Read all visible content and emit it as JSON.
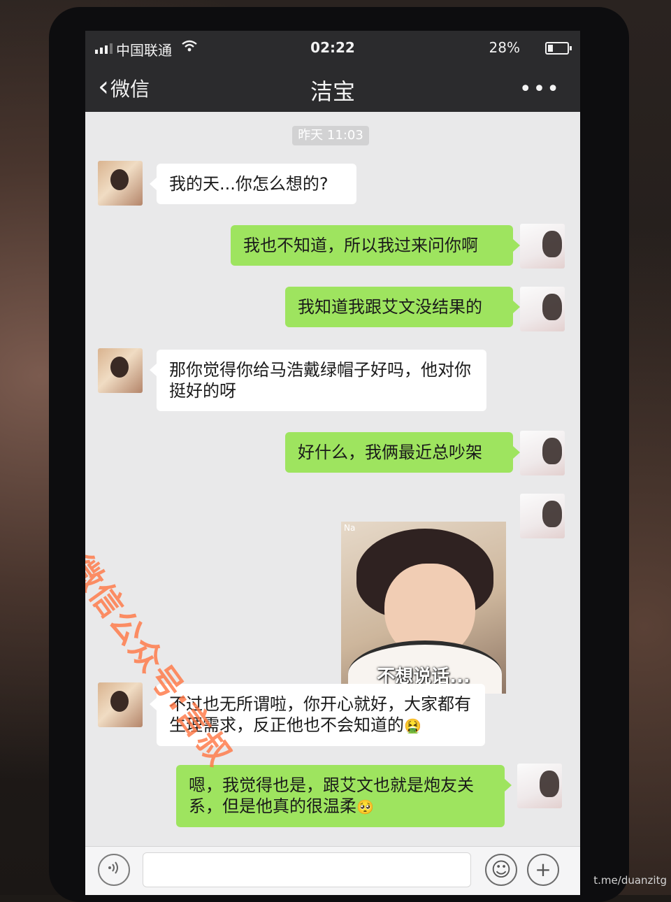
{
  "status_bar": {
    "carrier": "中国联通",
    "time": "02:22",
    "battery_percent": "28%",
    "battery_level": 0.28,
    "icons": [
      "signal-icon",
      "wifi-icon",
      "battery-icon"
    ]
  },
  "nav": {
    "back_label": "微信",
    "title": "洁宝",
    "more_label": "•••"
  },
  "chat": {
    "timestamp": "昨天 11:03",
    "messages": [
      {
        "side": "left",
        "text": "我的天...你怎么想的?"
      },
      {
        "side": "right",
        "text": "我也不知道，所以我过来问你啊"
      },
      {
        "side": "right",
        "text": "我知道我跟艾文没结果的"
      },
      {
        "side": "left",
        "text": "那你觉得你给马浩戴绿帽子好吗，他对你挺好的呀"
      },
      {
        "side": "right",
        "text": "好什么，我俩最近总吵架"
      },
      {
        "side": "right",
        "sticker_caption": "不想说话...",
        "sticker_tag": "Na"
      },
      {
        "side": "left",
        "text": "不过也无所谓啦，你开心就好，大家都有生理需求，反正他也不会知道的",
        "emoji": "🤮"
      },
      {
        "side": "right",
        "text": "嗯，我觉得也是，跟艾文也就是炮友关系，但是他真的很温柔",
        "emoji": "🥺"
      }
    ]
  },
  "watermark": "微信公众号:言叔",
  "input_bar": {
    "voice_icon": "voice-icon",
    "emoji_icon": "emoji-icon",
    "plus_icon": "plus-icon"
  },
  "credit": "t.me/duanzitg"
}
